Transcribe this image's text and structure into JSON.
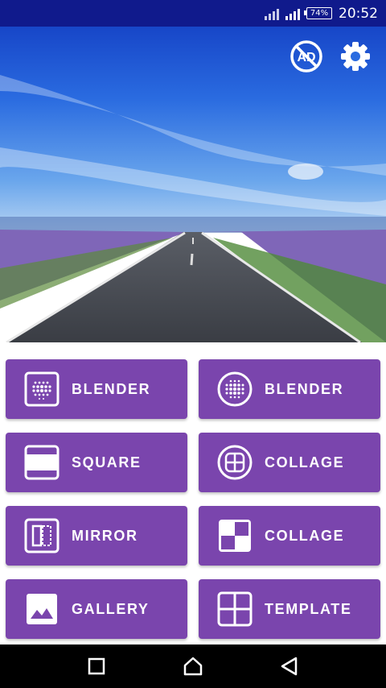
{
  "status_bar": {
    "battery": "74%",
    "time": "20:52"
  },
  "hero": {
    "no_ads_icon": "no-ads-icon",
    "settings_icon": "gear-icon"
  },
  "tiles": [
    {
      "label": "BLENDER",
      "icon": "blend-square-icon"
    },
    {
      "label": "BLENDER",
      "icon": "blend-circle-icon"
    },
    {
      "label": "SQUARE",
      "icon": "square-crop-icon"
    },
    {
      "label": "COLLAGE",
      "icon": "collage-circle-icon"
    },
    {
      "label": "MIRROR",
      "icon": "mirror-icon"
    },
    {
      "label": "COLLAGE",
      "icon": "collage-checker-icon"
    },
    {
      "label": "GALLERY",
      "icon": "gallery-icon"
    },
    {
      "label": "TEMPLATE",
      "icon": "template-grid-icon"
    }
  ],
  "colors": {
    "status_bar": "#101a8c",
    "tile": "#7a45ad",
    "nav_bar": "#000000"
  }
}
